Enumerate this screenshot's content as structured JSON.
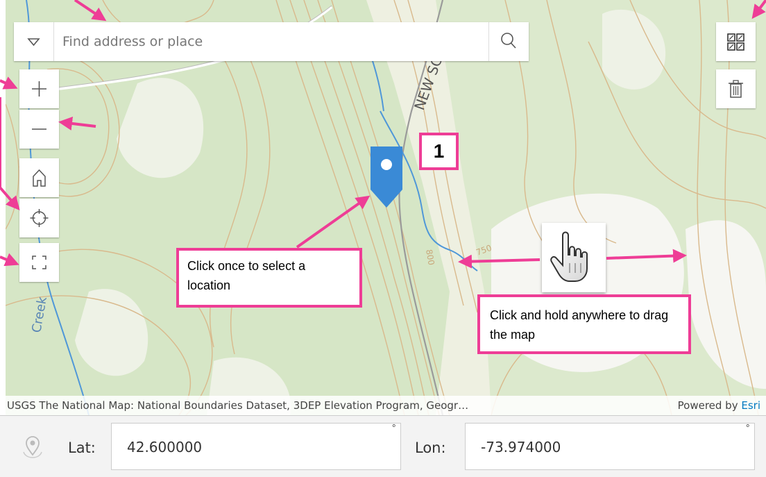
{
  "search": {
    "placeholder": "Find address or place"
  },
  "map_labels": {
    "road": "NEW SC",
    "creek": "Creek",
    "contour_a": "750",
    "contour_b": "800"
  },
  "badge": {
    "number": "1"
  },
  "callouts": {
    "select": "Click once to select a location",
    "drag": "Click and hold anywhere to drag the map"
  },
  "attribution": {
    "text": "USGS The National Map: National Boundaries Dataset, 3DEP Elevation Program, Geogr…",
    "powered_prefix": "Powered by ",
    "powered_link": "Esri"
  },
  "coords": {
    "lat_label": "Lat:",
    "lat_value": "42.600000",
    "lon_label": "Lon:",
    "lon_value": "-73.974000",
    "degree_symbol": "°"
  },
  "icons": {
    "search_toggle": "chevron-down-icon",
    "search": "search-icon",
    "zoom_in": "plus-icon",
    "zoom_out": "minus-icon",
    "home": "home-icon",
    "locate": "locate-icon",
    "fullscreen": "fullscreen-icon",
    "basemap": "basemap-gallery-icon",
    "trash": "trash-icon",
    "pin": "map-pin-icon",
    "hand": "hand-cursor-icon"
  },
  "colors": {
    "annotation": "#ee3d96",
    "pin": "#3a8ad6",
    "water": "#4f97d8",
    "contour": "#d9b98c",
    "vegetation": "#cfe2bf",
    "esri_link": "#0079c1"
  }
}
